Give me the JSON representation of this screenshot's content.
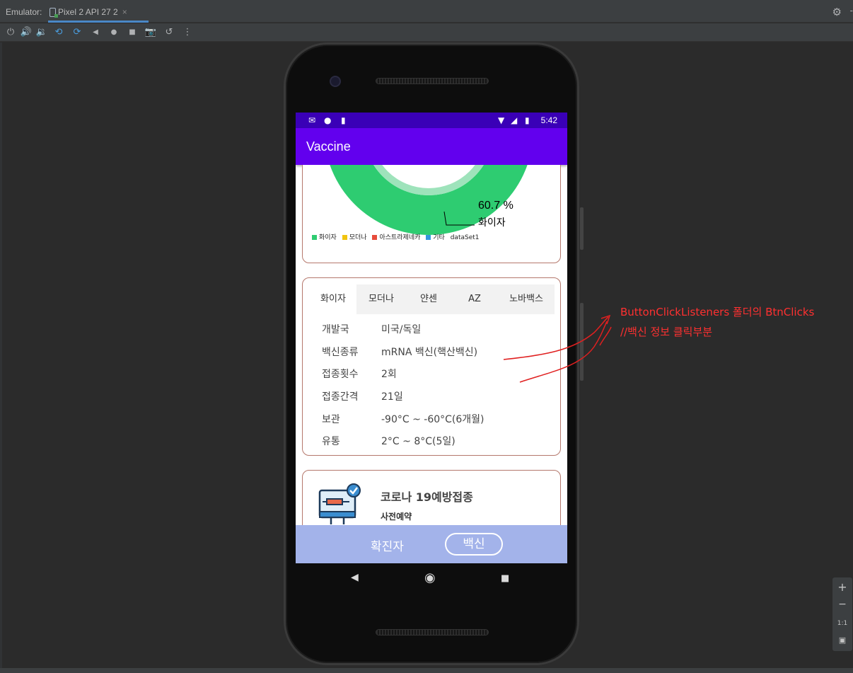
{
  "ide": {
    "emulator_label": "Emulator:",
    "device_tab": "Pixel 2 API 27 2",
    "tab_close": "×",
    "toolbar_icons": [
      "power-icon",
      "volume-up-icon",
      "volume-down-icon",
      "rotate-left-icon",
      "rotate-right-icon",
      "back-icon",
      "home-icon",
      "overview-icon",
      "screenshot-icon",
      "snapshot-icon",
      "more-icon"
    ]
  },
  "status": {
    "time": "5:42"
  },
  "app": {
    "title": "Vaccine"
  },
  "chart_data": {
    "type": "pie",
    "title": "",
    "categories": [
      "화이자",
      "모더나",
      "아스트라제네카",
      "기타"
    ],
    "highlighted": {
      "label": "화이자",
      "value_label": "60.7 %",
      "value": 60.7
    },
    "legend": [
      "화이자",
      "모더나",
      "아스트라제네카",
      "기타",
      "dataSet1"
    ],
    "colors": [
      "#2ecc71",
      "#f1c40f",
      "#e74c3c",
      "#3498db"
    ]
  },
  "vaccine_tabs": [
    "화이자",
    "모더나",
    "얀센",
    "AZ",
    "노바백스"
  ],
  "vaccine_info": [
    {
      "key": "개발국",
      "value": "미국/독일"
    },
    {
      "key": "백신종류",
      "value": "mRNA 백신(핵산백신)"
    },
    {
      "key": "접종횟수",
      "value": "2회"
    },
    {
      "key": "접종간격",
      "value": "21일"
    },
    {
      "key": "보관",
      "value": "-90°C ~ -60°C(6개월)"
    },
    {
      "key": "유통",
      "value": "2°C ~ 8°C(5일)"
    }
  ],
  "reservation_card": {
    "title": "코로나 19예방접종",
    "subtitle": "사전예약"
  },
  "bottom_nav": {
    "confirmed": "확진자",
    "vaccine": "백신"
  },
  "annotation": {
    "line1": "ButtonClickListeners 폴더의 BtnClicks",
    "line2": "//백신 정보 클릭부분"
  },
  "zoom": {
    "plus": "+",
    "minus": "−",
    "one_to_one": "1:1"
  },
  "colors": {
    "app_bar": "#6200ee",
    "status_bar": "#3a00b7",
    "bottom_bar": "#a3b3ea",
    "card_border": "#b5786c",
    "annotation": "#ff3030"
  }
}
